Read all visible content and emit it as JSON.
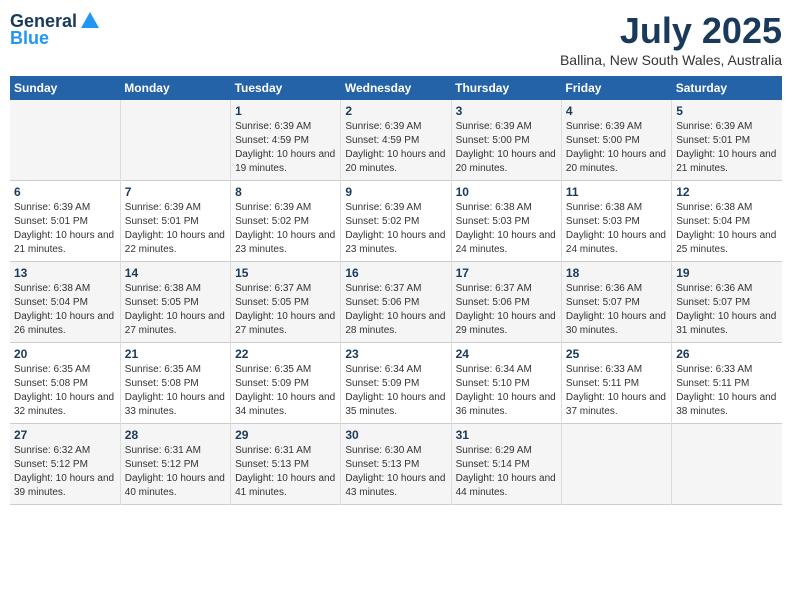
{
  "logo": {
    "general": "General",
    "blue": "Blue"
  },
  "title": {
    "month_year": "July 2025",
    "location": "Ballina, New South Wales, Australia"
  },
  "headers": [
    "Sunday",
    "Monday",
    "Tuesday",
    "Wednesday",
    "Thursday",
    "Friday",
    "Saturday"
  ],
  "weeks": [
    [
      {
        "day": "",
        "info": ""
      },
      {
        "day": "",
        "info": ""
      },
      {
        "day": "1",
        "info": "Sunrise: 6:39 AM\nSunset: 4:59 PM\nDaylight: 10 hours and 19 minutes."
      },
      {
        "day": "2",
        "info": "Sunrise: 6:39 AM\nSunset: 4:59 PM\nDaylight: 10 hours and 20 minutes."
      },
      {
        "day": "3",
        "info": "Sunrise: 6:39 AM\nSunset: 5:00 PM\nDaylight: 10 hours and 20 minutes."
      },
      {
        "day": "4",
        "info": "Sunrise: 6:39 AM\nSunset: 5:00 PM\nDaylight: 10 hours and 20 minutes."
      },
      {
        "day": "5",
        "info": "Sunrise: 6:39 AM\nSunset: 5:01 PM\nDaylight: 10 hours and 21 minutes."
      }
    ],
    [
      {
        "day": "6",
        "info": "Sunrise: 6:39 AM\nSunset: 5:01 PM\nDaylight: 10 hours and 21 minutes."
      },
      {
        "day": "7",
        "info": "Sunrise: 6:39 AM\nSunset: 5:01 PM\nDaylight: 10 hours and 22 minutes."
      },
      {
        "day": "8",
        "info": "Sunrise: 6:39 AM\nSunset: 5:02 PM\nDaylight: 10 hours and 23 minutes."
      },
      {
        "day": "9",
        "info": "Sunrise: 6:39 AM\nSunset: 5:02 PM\nDaylight: 10 hours and 23 minutes."
      },
      {
        "day": "10",
        "info": "Sunrise: 6:38 AM\nSunset: 5:03 PM\nDaylight: 10 hours and 24 minutes."
      },
      {
        "day": "11",
        "info": "Sunrise: 6:38 AM\nSunset: 5:03 PM\nDaylight: 10 hours and 24 minutes."
      },
      {
        "day": "12",
        "info": "Sunrise: 6:38 AM\nSunset: 5:04 PM\nDaylight: 10 hours and 25 minutes."
      }
    ],
    [
      {
        "day": "13",
        "info": "Sunrise: 6:38 AM\nSunset: 5:04 PM\nDaylight: 10 hours and 26 minutes."
      },
      {
        "day": "14",
        "info": "Sunrise: 6:38 AM\nSunset: 5:05 PM\nDaylight: 10 hours and 27 minutes."
      },
      {
        "day": "15",
        "info": "Sunrise: 6:37 AM\nSunset: 5:05 PM\nDaylight: 10 hours and 27 minutes."
      },
      {
        "day": "16",
        "info": "Sunrise: 6:37 AM\nSunset: 5:06 PM\nDaylight: 10 hours and 28 minutes."
      },
      {
        "day": "17",
        "info": "Sunrise: 6:37 AM\nSunset: 5:06 PM\nDaylight: 10 hours and 29 minutes."
      },
      {
        "day": "18",
        "info": "Sunrise: 6:36 AM\nSunset: 5:07 PM\nDaylight: 10 hours and 30 minutes."
      },
      {
        "day": "19",
        "info": "Sunrise: 6:36 AM\nSunset: 5:07 PM\nDaylight: 10 hours and 31 minutes."
      }
    ],
    [
      {
        "day": "20",
        "info": "Sunrise: 6:35 AM\nSunset: 5:08 PM\nDaylight: 10 hours and 32 minutes."
      },
      {
        "day": "21",
        "info": "Sunrise: 6:35 AM\nSunset: 5:08 PM\nDaylight: 10 hours and 33 minutes."
      },
      {
        "day": "22",
        "info": "Sunrise: 6:35 AM\nSunset: 5:09 PM\nDaylight: 10 hours and 34 minutes."
      },
      {
        "day": "23",
        "info": "Sunrise: 6:34 AM\nSunset: 5:09 PM\nDaylight: 10 hours and 35 minutes."
      },
      {
        "day": "24",
        "info": "Sunrise: 6:34 AM\nSunset: 5:10 PM\nDaylight: 10 hours and 36 minutes."
      },
      {
        "day": "25",
        "info": "Sunrise: 6:33 AM\nSunset: 5:11 PM\nDaylight: 10 hours and 37 minutes."
      },
      {
        "day": "26",
        "info": "Sunrise: 6:33 AM\nSunset: 5:11 PM\nDaylight: 10 hours and 38 minutes."
      }
    ],
    [
      {
        "day": "27",
        "info": "Sunrise: 6:32 AM\nSunset: 5:12 PM\nDaylight: 10 hours and 39 minutes."
      },
      {
        "day": "28",
        "info": "Sunrise: 6:31 AM\nSunset: 5:12 PM\nDaylight: 10 hours and 40 minutes."
      },
      {
        "day": "29",
        "info": "Sunrise: 6:31 AM\nSunset: 5:13 PM\nDaylight: 10 hours and 41 minutes."
      },
      {
        "day": "30",
        "info": "Sunrise: 6:30 AM\nSunset: 5:13 PM\nDaylight: 10 hours and 43 minutes."
      },
      {
        "day": "31",
        "info": "Sunrise: 6:29 AM\nSunset: 5:14 PM\nDaylight: 10 hours and 44 minutes."
      },
      {
        "day": "",
        "info": ""
      },
      {
        "day": "",
        "info": ""
      }
    ]
  ]
}
